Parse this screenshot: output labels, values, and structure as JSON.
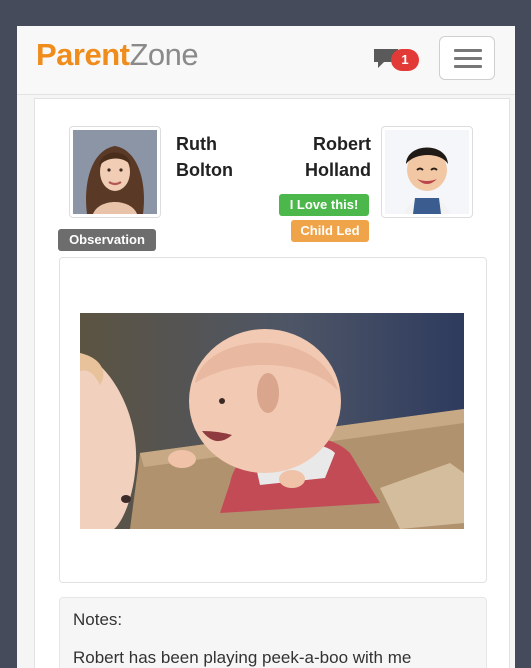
{
  "brand": {
    "part1": "Parent",
    "part2": "Zone",
    "color_part1": "#f08c1c",
    "color_part2": "#8a8a8a"
  },
  "header": {
    "message_icon": "chat-bubble-icon",
    "notification_count": "1",
    "menu_icon": "hamburger-menu-icon"
  },
  "observation": {
    "staff": {
      "first_name": "Ruth",
      "last_name": "Bolton"
    },
    "child": {
      "first_name": "Robert",
      "last_name": "Holland"
    },
    "tags": [
      {
        "label": "I Love this!",
        "color": "#4cb84c"
      },
      {
        "label": "Child Led",
        "color": "#f0a44a"
      }
    ],
    "type_label": "Observation",
    "type_color": "#6d6d6d"
  },
  "notes": {
    "title": "Notes:",
    "text": "Robert has been playing peek-a-boo with me"
  }
}
